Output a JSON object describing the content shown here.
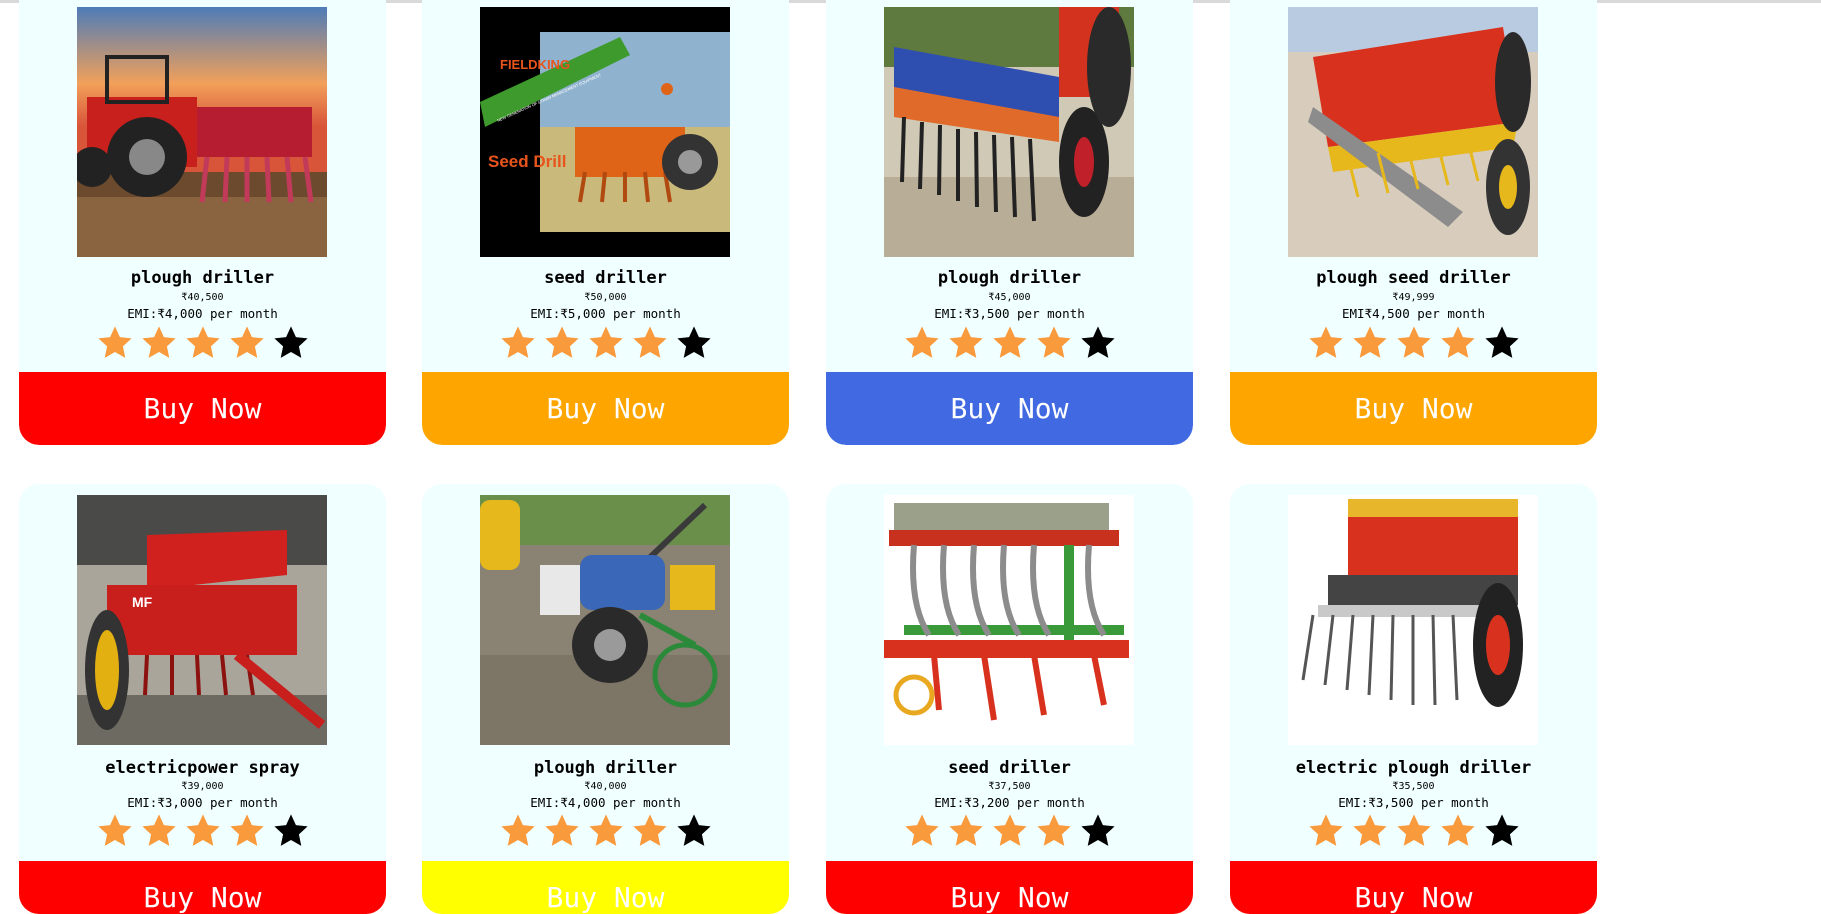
{
  "colors": {
    "card_background": "#f0ffff",
    "star_filled": "#f99a3c",
    "star_empty": "#000000",
    "text": "#000000",
    "button_text": "#ffffff"
  },
  "products": [
    {
      "name": "plough driller",
      "price": "₹40,500",
      "emi": "EMI:₹4,000 per month",
      "rating": 4,
      "max_rating": 5,
      "button_label": "Buy Now",
      "button_color": "#ff0000",
      "image": "red tractor with seed drill at sunset"
    },
    {
      "name": "seed driller",
      "price": "₹50,000",
      "emi": "EMI:₹5,000 per month",
      "rating": 4,
      "max_rating": 5,
      "button_label": "Buy Now",
      "button_color": "#ffa500",
      "image": "FIELDKING seed drill advertisement",
      "image_text": {
        "brand": "FIELDKING",
        "banner": "NEW GENERATION OF STRAW MANAGEMENT EQUIPMENT",
        "caption": "Seed Drill"
      }
    },
    {
      "name": "plough driller",
      "price": "₹45,000",
      "emi": "EMI:₹3,500 per month",
      "rating": 4,
      "max_rating": 5,
      "button_label": "Buy Now",
      "button_color": "#4169e1",
      "image": "blue seed drill attached to tractor"
    },
    {
      "name": "plough seed driller",
      "price": "₹49,999",
      "emi": "EMI₹4,500 per month",
      "rating": 4,
      "max_rating": 5,
      "button_label": "Buy Now",
      "button_color": "#ffa500",
      "image": "red seed drill in field"
    },
    {
      "name": "electricpower spray",
      "price": "₹39,000",
      "emi": "EMI:₹3,000 per month",
      "rating": 4,
      "max_rating": 5,
      "button_label": "Buy Now",
      "button_color": "#ff0000",
      "image": "red seed drill machine",
      "image_text": {
        "badge": "MF"
      }
    },
    {
      "name": "plough driller",
      "price": "₹40,000",
      "emi": "EMI:₹4,000 per month",
      "rating": 4,
      "max_rating": 5,
      "button_label": "Buy Now",
      "button_color": "#ffff00",
      "image": "walk-behind power tiller with planter"
    },
    {
      "name": "seed driller",
      "price": "₹37,500",
      "emi": "EMI:₹3,200 per month",
      "rating": 4,
      "max_rating": 5,
      "button_label": "Buy Now",
      "button_color": "#ff0000",
      "image": "red tined seed drill with hoses"
    },
    {
      "name": "electric plough driller",
      "price": "₹35,500",
      "emi": "EMI:₹3,500 per month",
      "rating": 4,
      "max_rating": 5,
      "button_label": "Buy Now",
      "button_color": "#ff0000",
      "image": "red pneumatic seed drill"
    }
  ]
}
